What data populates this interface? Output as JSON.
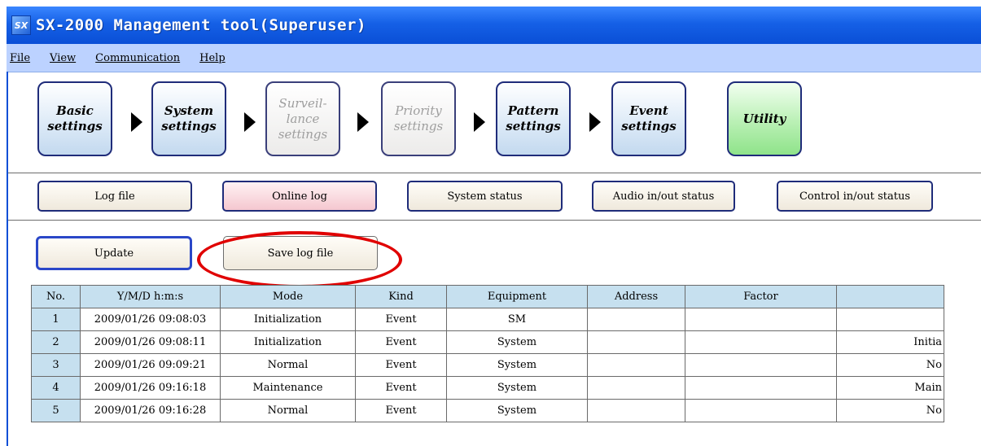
{
  "window": {
    "title": "SX-2000 Management tool(Superuser)",
    "icon": "SX"
  },
  "menu": {
    "items": [
      {
        "label": "File"
      },
      {
        "label": "View"
      },
      {
        "label": "Communication"
      },
      {
        "label": "Help"
      }
    ]
  },
  "steps": [
    {
      "label": "Basic\nsettings",
      "enabled": true
    },
    {
      "label": "System\nsettings",
      "enabled": true
    },
    {
      "label": "Surveil-\nlance\nsettings",
      "enabled": false
    },
    {
      "label": "Priority\nsettings",
      "enabled": false
    },
    {
      "label": "Pattern\nsettings",
      "enabled": true
    },
    {
      "label": "Event\nsettings",
      "enabled": true
    },
    {
      "label": "Utility",
      "enabled": true,
      "active": true
    }
  ],
  "tabs": [
    {
      "label": "Log file"
    },
    {
      "label": "Online log",
      "selected": true
    },
    {
      "label": "System status"
    },
    {
      "label": "Audio in/out status"
    },
    {
      "label": "Control in/out status"
    }
  ],
  "actions": {
    "update_label": "Update",
    "save_label": "Save log file"
  },
  "table": {
    "headers": [
      "No.",
      "Y/M/D h:m:s",
      "Mode",
      "Kind",
      "Equipment",
      "Address",
      "Factor",
      ""
    ],
    "rows": [
      [
        "1",
        "2009/01/26 09:08:03",
        "Initialization",
        "Event",
        "SM",
        "",
        "",
        ""
      ],
      [
        "2",
        "2009/01/26 09:08:11",
        "Initialization",
        "Event",
        "System",
        "",
        "",
        "Initia"
      ],
      [
        "3",
        "2009/01/26 09:09:21",
        "Normal",
        "Event",
        "System",
        "",
        "",
        "No"
      ],
      [
        "4",
        "2009/01/26 09:16:18",
        "Maintenance",
        "Event",
        "System",
        "",
        "",
        "Main"
      ],
      [
        "5",
        "2009/01/26 09:16:28",
        "Normal",
        "Event",
        "System",
        "",
        "",
        "No"
      ]
    ]
  },
  "colors": {
    "titlebar": "#1560e6",
    "menubar": "#bcd2ff",
    "header_cell": "#c6e0ef",
    "highlight": "#e00000"
  }
}
